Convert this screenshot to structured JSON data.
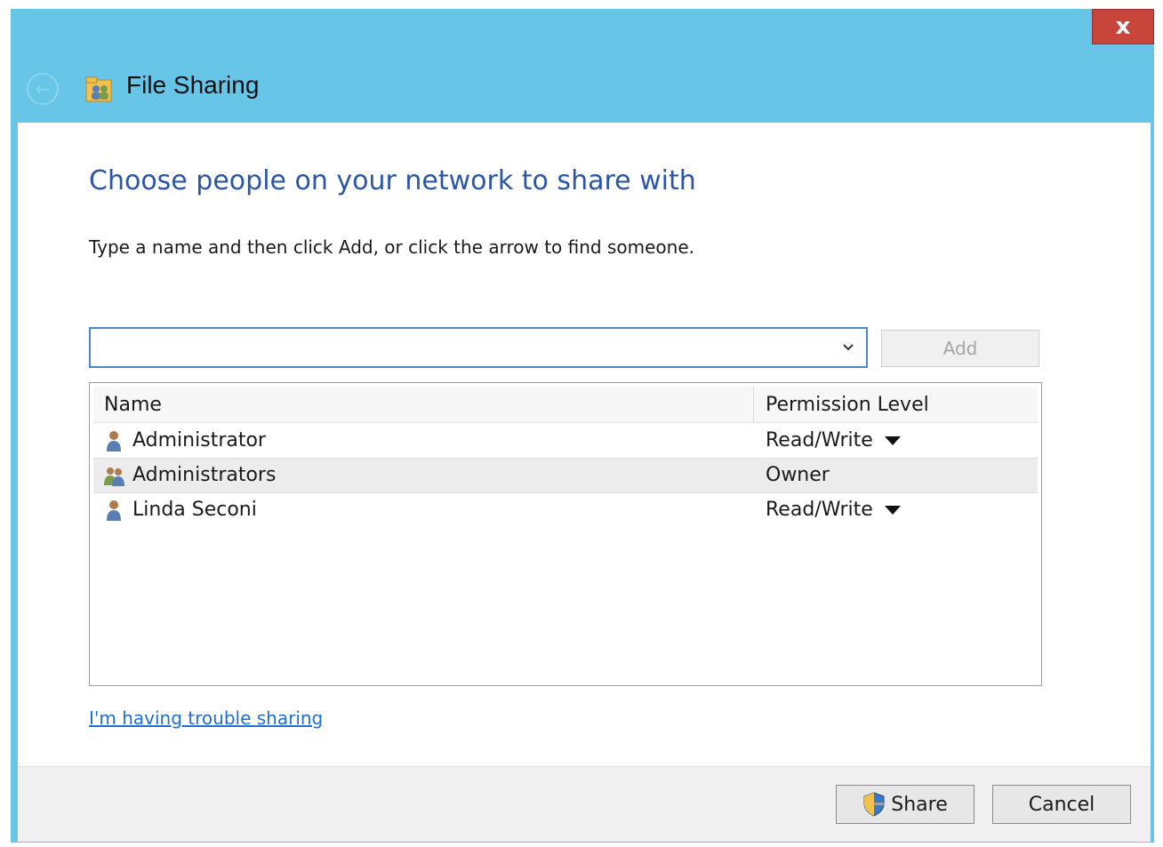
{
  "window": {
    "title": "File Sharing",
    "close_label": "x",
    "title_icon": "file-sharing-icon"
  },
  "main": {
    "heading": "Choose people on your network to share with",
    "instructions": "Type a name and then click Add, or click the arrow to find someone.",
    "name_input": {
      "value": "",
      "placeholder": ""
    },
    "add_label": "Add"
  },
  "list": {
    "columns": {
      "name": "Name",
      "permission": "Permission Level"
    },
    "rows": [
      {
        "name": "Administrator",
        "permission": "Read/Write",
        "icon": "user-icon",
        "has_dropdown": true
      },
      {
        "name": "Administrators",
        "permission": "Owner",
        "icon": "group-icon",
        "has_dropdown": false
      },
      {
        "name": "Linda Seconi",
        "permission": "Read/Write",
        "icon": "user-icon",
        "has_dropdown": true
      }
    ]
  },
  "links": {
    "trouble": "I'm having trouble sharing"
  },
  "footer": {
    "share_label": "Share",
    "cancel_label": "Cancel"
  },
  "colors": {
    "titlebar": "#67c6e8",
    "heading": "#2b56a8",
    "link": "#1e6fd1",
    "close": "#c7453a"
  }
}
